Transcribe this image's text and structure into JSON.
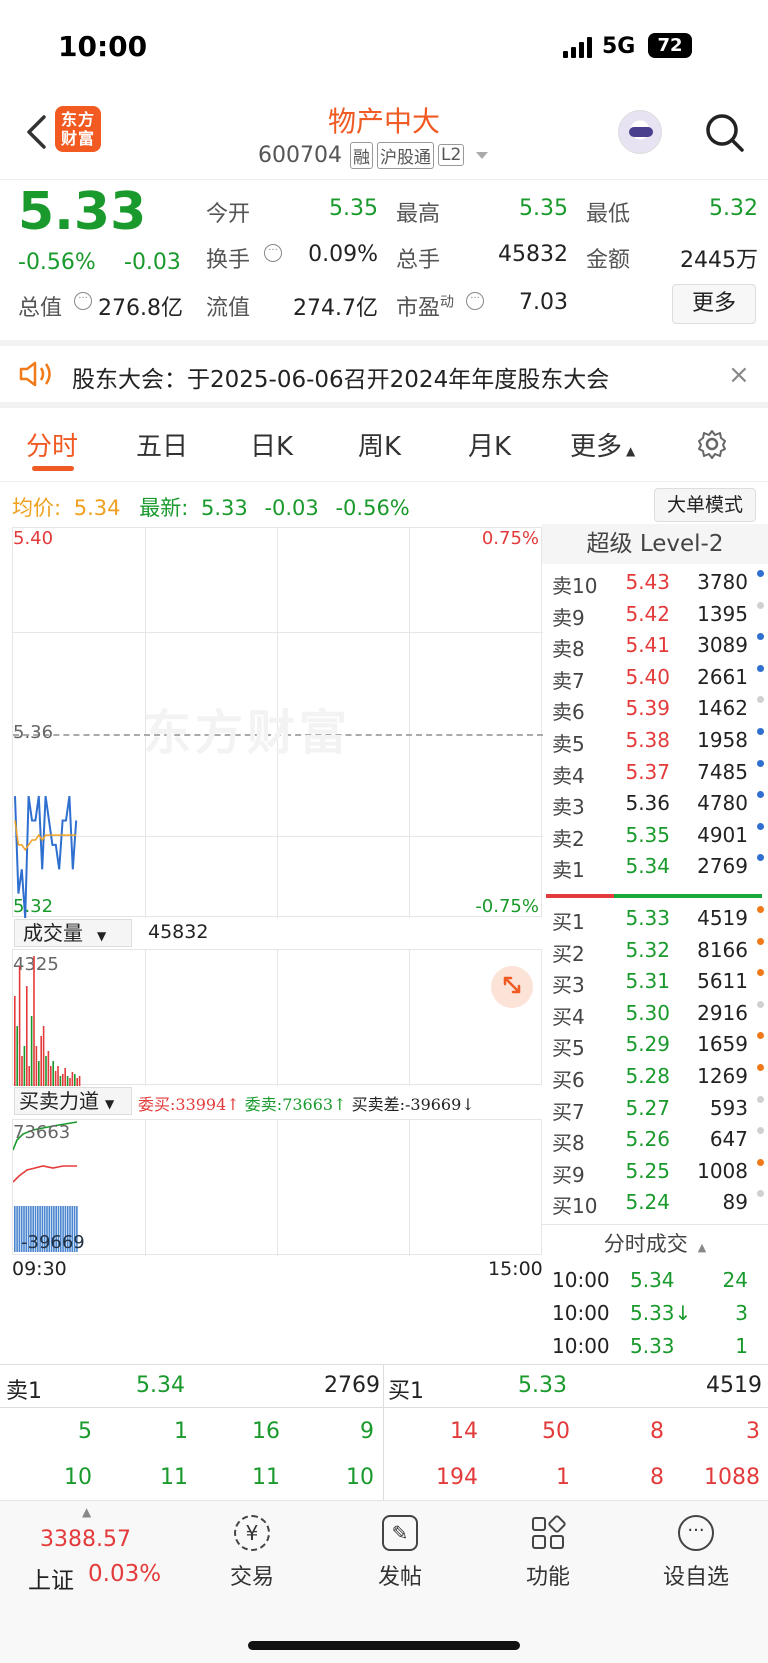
{
  "status": {
    "time": "10:00",
    "network": "5G",
    "battery": "72"
  },
  "header": {
    "logo": "东方财富",
    "name": "物产中大",
    "code": "600704",
    "tags": [
      "融",
      "沪股通",
      "L2"
    ]
  },
  "quote": {
    "price": "5.33",
    "change_pct": "-0.56%",
    "change": "-0.03",
    "open_label": "今开",
    "open": "5.35",
    "high_label": "最高",
    "high": "5.35",
    "low_label": "最低",
    "low": "5.32",
    "turnover_label": "换手",
    "turnover": "0.09%",
    "volume_label": "总手",
    "volume": "45832",
    "amount_label": "金额",
    "amount": "2445万",
    "mktcap_label": "总值",
    "mktcap": "276.8亿",
    "float_label": "流值",
    "float": "274.7亿",
    "pe_label": "市盈",
    "pe_sup": "动",
    "pe": "7.03",
    "more": "更多"
  },
  "notice": {
    "text": "股东大会：于2025-06-06召开2024年年度股东大会"
  },
  "tabs": [
    "分时",
    "五日",
    "日K",
    "周K",
    "月K",
    "更多"
  ],
  "chart_info": {
    "avg_label": "均价:",
    "avg": "5.34",
    "latest_label": "最新:",
    "latest": "5.33",
    "latest_chg": "-0.03",
    "latest_pct": "-0.56%",
    "mode_button": "大单模式",
    "y_top": "5.40",
    "y_mid": "5.36",
    "y_bot": "5.32",
    "pct_top": "0.75%",
    "pct_bot": "-0.75%",
    "watermark": "东方财富",
    "volume_label": "成交量",
    "volume_value": "45832",
    "volume_max": "4325",
    "force_label": "买卖力道",
    "force_buy": "委买:33994",
    "force_sell": "委卖:73663",
    "force_diff": "买卖差:-39669",
    "force_top": "73663",
    "force_bot": "-39669",
    "time_start": "09:30",
    "time_end": "15:00"
  },
  "orderbook": {
    "title": "超级 Level-2",
    "asks": [
      {
        "label": "卖10",
        "price": "5.43",
        "vol": "3780",
        "pc": "red",
        "dc": "blue"
      },
      {
        "label": "卖9",
        "price": "5.42",
        "vol": "1395",
        "pc": "red",
        "dc": "gray"
      },
      {
        "label": "卖8",
        "price": "5.41",
        "vol": "3089",
        "pc": "red",
        "dc": "blue"
      },
      {
        "label": "卖7",
        "price": "5.40",
        "vol": "2661",
        "pc": "red",
        "dc": "blue"
      },
      {
        "label": "卖6",
        "price": "5.39",
        "vol": "1462",
        "pc": "red",
        "dc": "gray"
      },
      {
        "label": "卖5",
        "price": "5.38",
        "vol": "1958",
        "pc": "red",
        "dc": "blue"
      },
      {
        "label": "卖4",
        "price": "5.37",
        "vol": "7485",
        "pc": "red",
        "dc": "blue"
      },
      {
        "label": "卖3",
        "price": "5.36",
        "vol": "4780",
        "pc": "black",
        "dc": "blue"
      },
      {
        "label": "卖2",
        "price": "5.35",
        "vol": "4901",
        "pc": "green",
        "dc": "blue"
      },
      {
        "label": "卖1",
        "price": "5.34",
        "vol": "2769",
        "pc": "green",
        "dc": "blue"
      }
    ],
    "bids": [
      {
        "label": "买1",
        "price": "5.33",
        "vol": "4519",
        "pc": "green",
        "dc": "orange"
      },
      {
        "label": "买2",
        "price": "5.32",
        "vol": "8166",
        "pc": "green",
        "dc": "orange"
      },
      {
        "label": "买3",
        "price": "5.31",
        "vol": "5611",
        "pc": "green",
        "dc": "orange"
      },
      {
        "label": "买4",
        "price": "5.30",
        "vol": "2916",
        "pc": "green",
        "dc": "gray"
      },
      {
        "label": "买5",
        "price": "5.29",
        "vol": "1659",
        "pc": "green",
        "dc": "orange"
      },
      {
        "label": "买6",
        "price": "5.28",
        "vol": "1269",
        "pc": "green",
        "dc": "orange"
      },
      {
        "label": "买7",
        "price": "5.27",
        "vol": "593",
        "pc": "green",
        "dc": "gray"
      },
      {
        "label": "买8",
        "price": "5.26",
        "vol": "647",
        "pc": "green",
        "dc": "gray"
      },
      {
        "label": "买9",
        "price": "5.25",
        "vol": "1008",
        "pc": "green",
        "dc": "orange"
      },
      {
        "label": "买10",
        "price": "5.24",
        "vol": "89",
        "pc": "green",
        "dc": "gray"
      }
    ],
    "trades_title": "分时成交",
    "trades": [
      {
        "time": "10:00",
        "price": "5.34",
        "vol": "24",
        "vc": "green"
      },
      {
        "time": "10:00",
        "price": "5.33↓",
        "vol": "3",
        "vc": "green"
      },
      {
        "time": "10:00",
        "price": "5.33",
        "vol": "1",
        "vc": "green"
      }
    ]
  },
  "summary": {
    "sell_label": "卖1",
    "sell_price": "5.34",
    "sell_vol": "2769",
    "buy_label": "买1",
    "buy_price": "5.33",
    "buy_vol": "4519",
    "sell_row1": [
      "5",
      "1",
      "16",
      "9"
    ],
    "sell_row2": [
      "10",
      "11",
      "11",
      "10"
    ],
    "buy_row1": [
      "14",
      "50",
      "8",
      "3"
    ],
    "buy_row2": [
      "194",
      "1",
      "8",
      "1088"
    ]
  },
  "bottom_nav": {
    "index_value": "3388.57",
    "index_name": "上证",
    "index_pct": "0.03%",
    "items": [
      "交易",
      "发帖",
      "功能",
      "设自选"
    ]
  },
  "chart_data": {
    "type": "line",
    "title": "",
    "ylim": [
      5.32,
      5.4
    ],
    "series": [
      {
        "values": [
          5.345,
          5.325,
          5.33,
          5.32,
          5.345,
          5.34,
          5.34,
          5.345,
          5.33,
          5.345,
          5.34,
          5.335,
          5.335,
          5.33,
          5.34,
          5.34,
          5.345,
          5.33,
          5.34
        ]
      },
      {
        "values": [
          5.34,
          5.335,
          5.335,
          5.334,
          5.335,
          5.336,
          5.336,
          5.337,
          5.336,
          5.337,
          5.337,
          5.337,
          5.337,
          5.337,
          5.337,
          5.337,
          5.337,
          5.337,
          5.337
        ]
      }
    ]
  }
}
